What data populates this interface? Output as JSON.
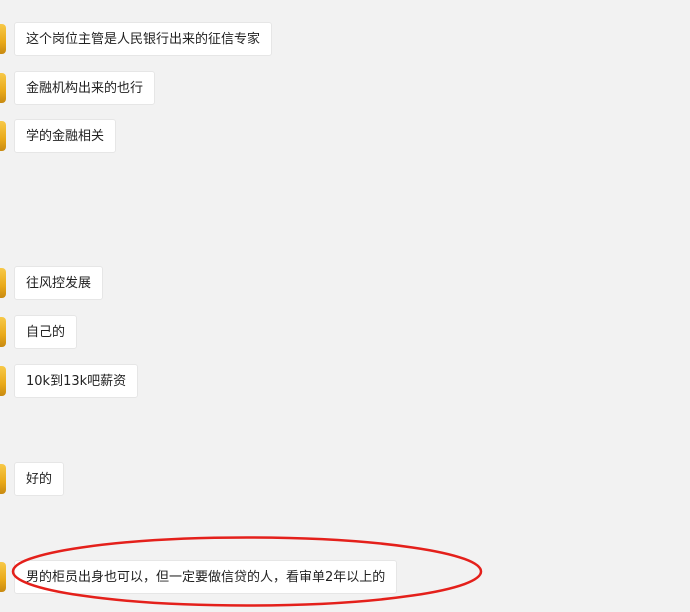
{
  "messages": [
    {
      "text": "这个岗位主管是人民银行出来的征信专家"
    },
    {
      "text": "金融机构出来的也行"
    },
    {
      "text": "学的金融相关"
    },
    {
      "text": "往风控发展"
    },
    {
      "text": "自己的"
    },
    {
      "text": "10k到13k吧薪资"
    },
    {
      "text": "好的"
    },
    {
      "text": "男的柜员出身也可以，但一定要做信贷的人，看审单2年以上的"
    }
  ],
  "colors": {
    "background": "#f2f2f2",
    "bubble": "#ffffff",
    "highlight": "#e4201b",
    "avatar": "#f0b429"
  }
}
